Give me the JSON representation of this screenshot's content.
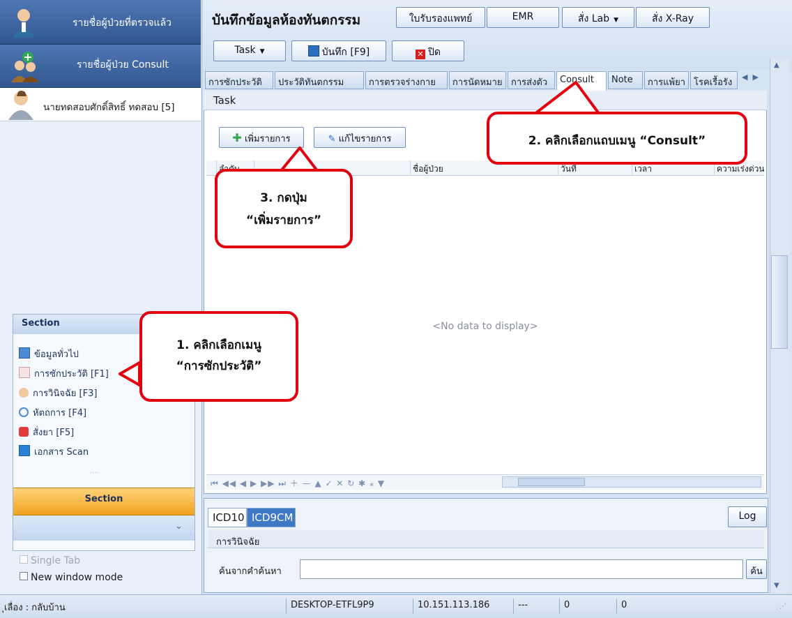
{
  "left": {
    "checked_patients": "รายชื่อผู้ป่วยที่ตรวจแล้ว",
    "consult_patients": "รายชื่อผู้ป่วย Consult",
    "selected_patient": "นายทดสอบศักดิ์สิทธิ์ ทดสอบ [5]",
    "section_title": "Section",
    "section_items": [
      "ข้อมูลทั่วไป",
      "การซักประวัติ [F1]",
      "การวินิจฉัย [F3]",
      "หัตถการ [F4]",
      "สั่งยา [F5]",
      "เอกสาร Scan"
    ],
    "section_orange": "Section",
    "single_tab": "Single Tab",
    "new_window": "New window mode"
  },
  "header": {
    "title": "บันทึกข้อมูลห้องทันตกรรม",
    "btn_cert": "ใบรับรองแพทย์",
    "btn_emr": "EMR",
    "btn_lab": "สั่ง Lab",
    "btn_xray": "สั่ง X-Ray",
    "task": "Task",
    "save": "บันทึก [F9]",
    "close": "ปิด"
  },
  "tabs": [
    "การซักประวัติ",
    "ประวัติทันตกรรม",
    "การตรวจร่างกาย",
    "การนัดหมาย",
    "การส่งตัว",
    "Consult",
    "Note",
    "การแพ้ยา",
    "โรคเรื้อรัง"
  ],
  "content": {
    "task_label": "Task",
    "add_item": "เพิ่มรายการ",
    "edit_item": "แก้ไขรายการ",
    "columns": [
      "ลำดับ",
      "ชื่อผู้ป่วย",
      "วันที่",
      "เวลา",
      "ความเร่งด่วน"
    ],
    "no_data": "<No data to display>",
    "navigator": "⏮ ◀◀ ◀ ▶ ▶▶ ⏭ ＋ — ▲ ✓ ✕ ↻ ✱ ⁎ ▼"
  },
  "lower": {
    "tab_icd10": "ICD10",
    "tab_icd9": "ICD9CM",
    "log": "Log",
    "diagnosis": "การวินิจฉัย",
    "search_label": "ค้นจากคำค้นหา",
    "search_btn": "ค้น"
  },
  "status": {
    "left": "ุเลื่อง : กลับบ้าน",
    "host": "DESKTOP-ETFL9P9",
    "ip": "10.151.113.186",
    "dash": "---",
    "n1": "0",
    "n2": "0"
  },
  "callouts": {
    "c1_line1": "1. คลิกเลือกเมนู",
    "c1_line2": "“การซักประวัติ”",
    "c2": "2. คลิกเลือกแถบเมนู “Consult”",
    "c3_line1": "3. กดปุ่ม",
    "c3_line2": "“เพิ่มรายการ”"
  },
  "colors": {
    "accent_red": "#e3000f",
    "header_blue": "#32578f",
    "section_orange": "#f2a21e"
  }
}
